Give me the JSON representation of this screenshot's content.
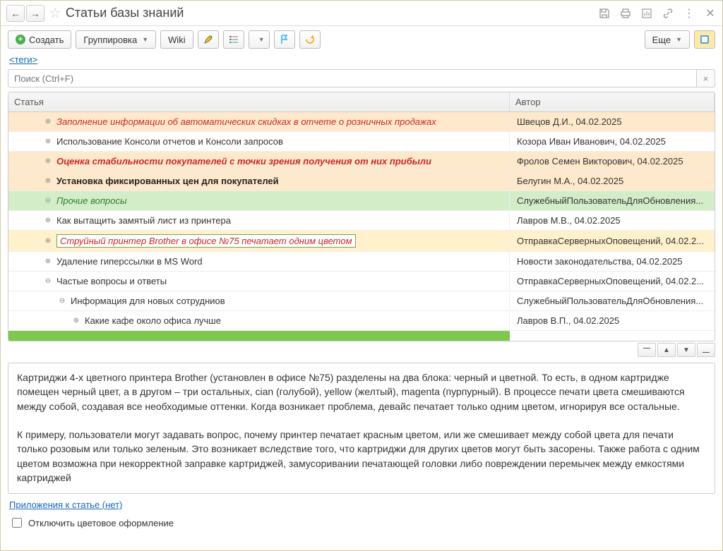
{
  "window": {
    "title": "Статьи базы знаний"
  },
  "toolbar": {
    "create": "Создать",
    "grouping": "Группировка",
    "wiki": "Wiki",
    "more": "Еще"
  },
  "tags_link": "<теги>",
  "search": {
    "placeholder": "Поиск (Ctrl+F)"
  },
  "columns": {
    "article": "Статья",
    "author": "Автор"
  },
  "rows": [
    {
      "indent": 1,
      "exp": "plus",
      "bg": "peach",
      "style": "red-italic",
      "article": "Заполнение информации об автоматических скидках в отчете о розничных продажах",
      "author": "Швецов Д.И., 04.02.2025"
    },
    {
      "indent": 1,
      "exp": "plus",
      "bg": "",
      "style": "normal",
      "article": "Использование Консоли отчетов и Консоли запросов",
      "author": "Козора Иван Иванович, 04.02.2025"
    },
    {
      "indent": 1,
      "exp": "plus",
      "bg": "peach",
      "style": "red-italic-bold",
      "article": "Оценка стабильности покупателей с точки зрения получения от них прибыли",
      "author": "Фролов Семен Викторович, 04.02.2025"
    },
    {
      "indent": 1,
      "exp": "plus",
      "bg": "peach",
      "style": "bold",
      "article": "Установка фиксированных цен для покупателей",
      "author": "Белугин М.А., 04.02.2025"
    },
    {
      "indent": 0,
      "exp": "minus",
      "bg": "green",
      "style": "green-italic",
      "article": "Прочие вопросы",
      "author": "СлужебныйПользовательДляОбновления..."
    },
    {
      "indent": 1,
      "exp": "plus",
      "bg": "",
      "style": "normal",
      "article": "Как вытащить замятый лист из принтера",
      "author": "Лавров М.В., 04.02.2025"
    },
    {
      "indent": 1,
      "exp": "plus",
      "bg": "yellow",
      "style": "red-italic",
      "selected": true,
      "article": "Струйный принтер Brother в офисе №75 печатает одним цветом",
      "author": "ОтправкаСерверныхОповещений, 04.02.2..."
    },
    {
      "indent": 1,
      "exp": "plus",
      "bg": "",
      "style": "normal",
      "article": "Удаление гиперссылки в MS Word",
      "author": "Новости законодательства, 04.02.2025"
    },
    {
      "indent": 1,
      "exp": "minus",
      "bg": "",
      "style": "normal",
      "article": "Частые вопросы и ответы",
      "author": "ОтправкаСерверныхОповещений, 04.02.2..."
    },
    {
      "indent": 2,
      "exp": "minus",
      "bg": "",
      "style": "normal",
      "article": "Информация для новых сотрудниов",
      "author": "СлужебныйПользовательДляОбновления..."
    },
    {
      "indent": 3,
      "exp": "plus",
      "bg": "",
      "style": "normal",
      "article": "Какие кафе около офиса лучше",
      "author": "Лавров В.П., 04.02.2025"
    }
  ],
  "content": {
    "p1": "Картриджи 4-х цветного принтера Brother (установлен в офисе №75) разделены на два блока: черный и цветной. То есть, в одном картридже помещен черный цвет, а в другом – три остальных, cian (голубой), yellow (желтый), magenta (пурпурный). В процессе печати цвета смешиваются между собой, создавая все необходимые оттенки. Когда возникает проблема, девайс печатает только одним цветом, игнорируя все остальные.",
    "p2": "К примеру, пользователи могут задавать вопрос, почему принтер печатает красным цветом, или же смешивает между собой цвета для печати только розовым или только зеленым. Это возникает вследствие того,  что картриджи для других цветов могут быть засорены. Также работа с одним цветом возможна при некорректной заправке картриджей, замусоривании печатающей головки либо повреждении перемычек между емкостями картриджей"
  },
  "attachments_link": "Приложения к статье (нет)",
  "disable_colors_label": "Отключить цветовое оформление"
}
